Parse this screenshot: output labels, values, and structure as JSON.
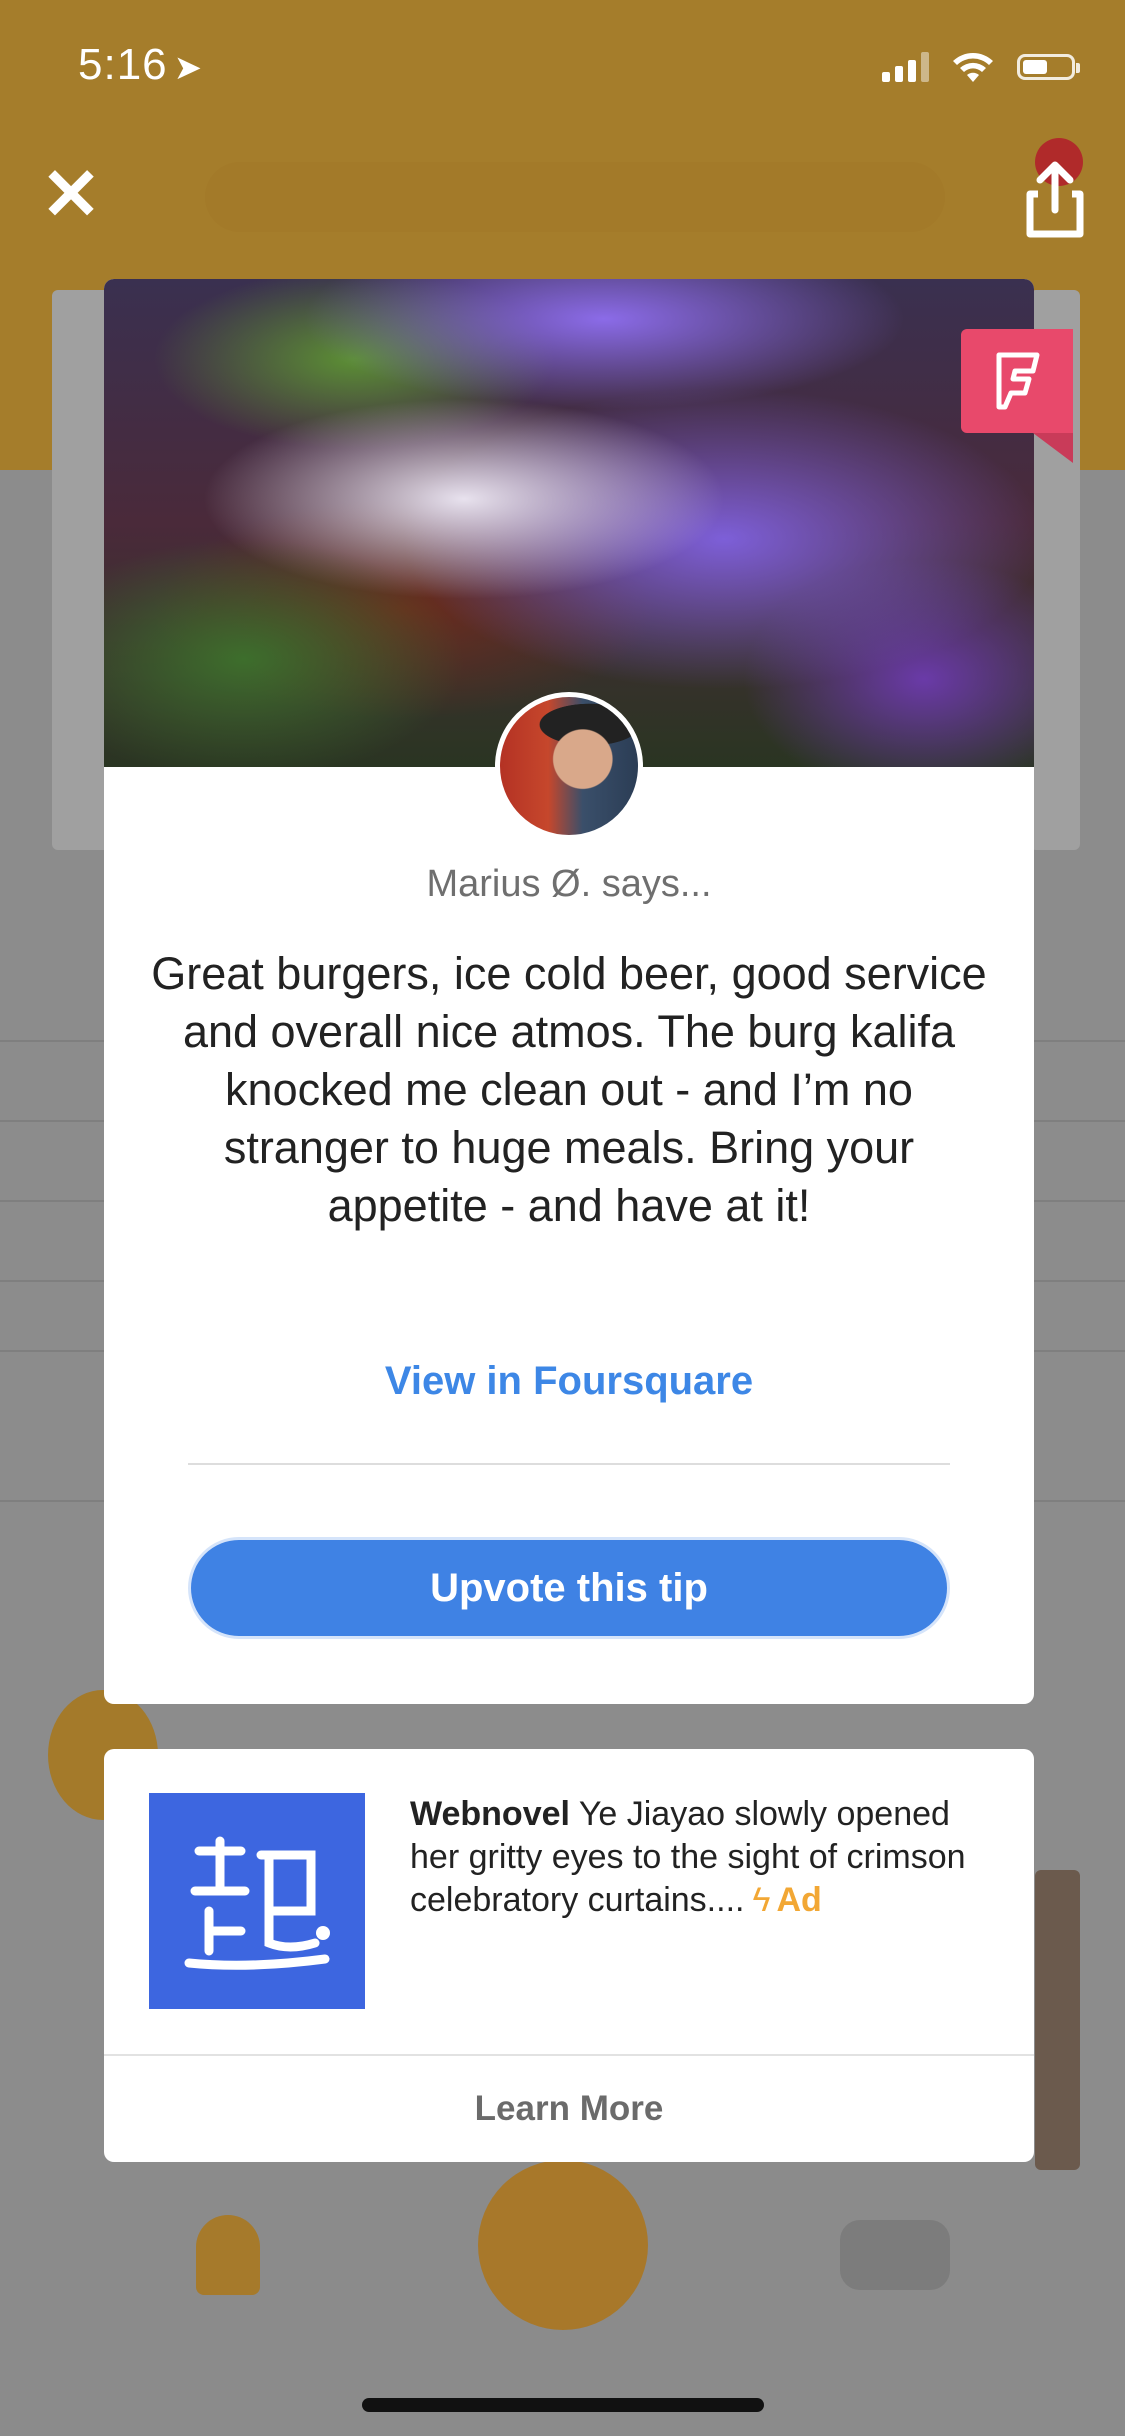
{
  "status_bar": {
    "time": "5:16",
    "location_icon": "location-arrow-icon",
    "icons": [
      "signal-icon",
      "wifi-icon",
      "battery-icon"
    ]
  },
  "top_bar": {
    "close_icon": "close-icon",
    "share_icon": "share-icon"
  },
  "tip": {
    "author_line": "Marius Ø. says...",
    "text": "Great burgers, ice cold beer, good service and overall nice atmos. The burg kalifa knocked me clean out - and I’m no stranger to huge meals. Bring your appetite - and have at it!",
    "view_link": "View in Foursquare",
    "upvote_label": "Upvote this tip",
    "source_icon": "foursquare-icon"
  },
  "ad": {
    "brand": "Webnovel",
    "body": "Ye Jiayao slowly opened her gritty eyes to the sight of crimson celebratory curtains....",
    "label": "Ad",
    "cta": "Learn More",
    "logo_icon": "webnovel-logo-icon"
  },
  "colors": {
    "accent_blue": "#3f82e4",
    "foursquare_pink": "#e8496b",
    "ad_orange": "#f2a734",
    "webnovel_blue": "#3d66e0"
  }
}
